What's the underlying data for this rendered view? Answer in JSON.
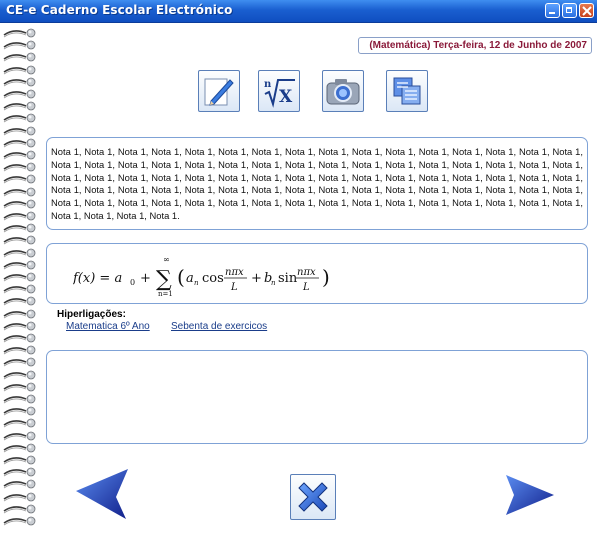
{
  "window": {
    "title": "CE-e  Caderno Escolar Electrónico"
  },
  "header": {
    "date": "(Matemática) Terça-feira, 12 de Junho de 2007"
  },
  "toolbar": {
    "icons": [
      "pencil-icon",
      "nth-root-icon",
      "camera-icon",
      "copy-icon"
    ]
  },
  "notes": {
    "text": "Nota 1, Nota 1, Nota 1, Nota 1, Nota 1, Nota 1, Nota 1, Nota 1, Nota 1, Nota 1, Nota 1, Nota 1, Nota 1, Nota 1, Nota 1, Nota 1, Nota 1, Nota 1, Nota 1, Nota 1, Nota 1, Nota 1, Nota 1, Nota 1, Nota 1, Nota 1, Nota 1, Nota 1, Nota 1, Nota 1, Nota 1, Nota 1, Nota 1, Nota 1, Nota 1, Nota 1, Nota 1, Nota 1, Nota 1, Nota 1, Nota 1, Nota 1, Nota 1, Nota 1, Nota 1, Nota 1, Nota 1, Nota 1, Nota 1, Nota 1, Nota 1, Nota 1, Nota 1, Nota 1, Nota 1, Nota 1, Nota 1, Nota 1, Nota 1, Nota 1, Nota 1, Nota 1, Nota 1, Nota 1, Nota 1, Nota 1, Nota 1, Nota 1, Nota 1, Nota 1, Nota 1, Nota 1, Nota 1, Nota 1, Nota 1, Nota 1, Nota 1, Nota 1, Nota 1, Nota 1, Nota 1, Nota 1, Nota 1, Nota 1."
  },
  "formula": {
    "lhs": "f(x) = a",
    "sub0": "0",
    "plus": "+",
    "sum_top": "∞",
    "sum_bottom": "n=1",
    "open": "(",
    "a": "a",
    "sub_n": "n",
    "cos": "cos",
    "npix": "nπx",
    "L": "L",
    "plus2": "+",
    "b": "b",
    "sin": "sin",
    "close": ")"
  },
  "links": {
    "title": "Hiperligações:",
    "items": [
      "Matematica 6º Ano",
      "Sebenta de exercicos"
    ]
  },
  "nav": {
    "prev": "arrow-left-icon",
    "close": "close-x-icon",
    "next": "arrow-right-icon"
  },
  "colors": {
    "titlebar": "#1a5fd0",
    "date_text": "#8a1a3a",
    "panel_border": "#7fa2d6",
    "link": "#1a3d8a",
    "arrow": "#1c2fa8"
  }
}
